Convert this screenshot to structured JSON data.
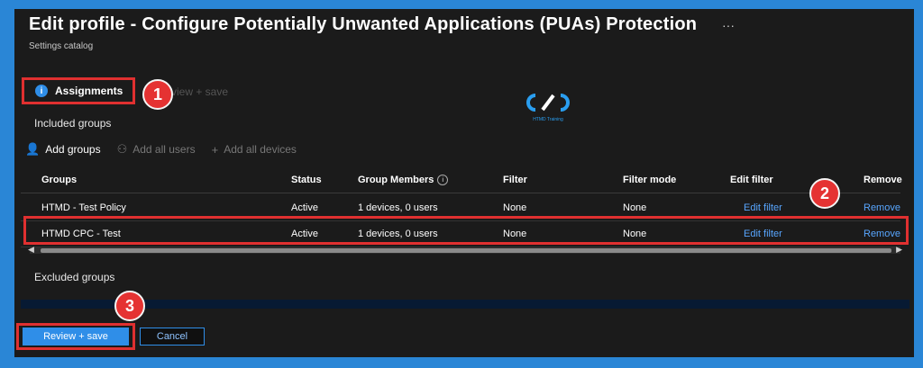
{
  "header": {
    "title": "Edit profile - Configure Potentially Unwanted Applications (PUAs) Protection",
    "subtitle": "Settings catalog",
    "more": "···"
  },
  "steps": {
    "active_label": "Assignments",
    "ghost_label": "view + save"
  },
  "logo": {
    "text": "HTMD Training"
  },
  "annotations": {
    "one": "1",
    "two": "2",
    "three": "3"
  },
  "included": {
    "label": "Included groups",
    "commands": {
      "add_groups": "Add groups",
      "add_users": "Add all users",
      "add_devices": "Add all devices"
    },
    "columns": {
      "groups": "Groups",
      "status": "Status",
      "members": "Group Members",
      "filter": "Filter",
      "filter_mode": "Filter mode",
      "edit_filter": "Edit filter",
      "remove": "Remove"
    },
    "rows": [
      {
        "group": "HTMD - Test Policy",
        "status": "Active",
        "members": "1 devices, 0 users",
        "filter": "None",
        "filter_mode": "None",
        "edit_filter": "Edit filter",
        "remove": "Remove"
      },
      {
        "group": "HTMD CPC - Test",
        "status": "Active",
        "members": "1 devices, 0 users",
        "filter": "None",
        "filter_mode": "None",
        "edit_filter": "Edit filter",
        "remove": "Remove"
      }
    ]
  },
  "excluded": {
    "label": "Excluded groups"
  },
  "footer": {
    "review_label": "Review + save",
    "cancel_label": "Cancel"
  },
  "colors": {
    "accent": "#2f8ee8",
    "annotation": "#e53232",
    "link": "#58a6ff"
  }
}
